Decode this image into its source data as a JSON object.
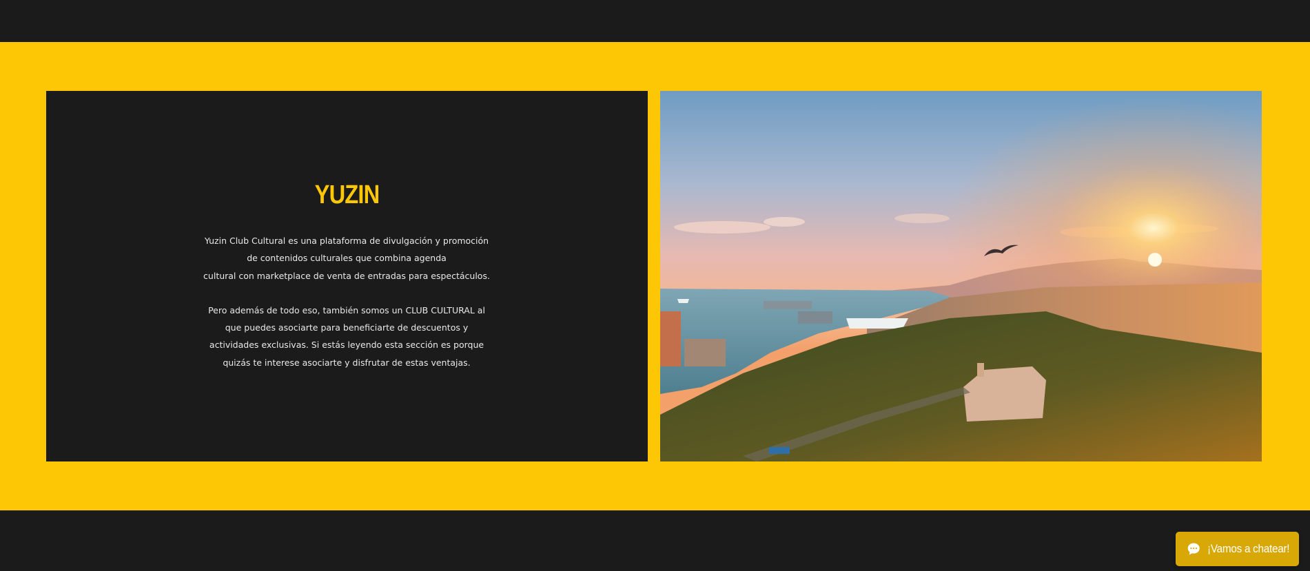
{
  "section": {
    "title": "YUZIN",
    "paragraph_1": [
      "Yuzin Club Cultural es una plataforma de divulgación y promoción",
      "de  contenidos culturales que combina agenda",
      "cultural con marketplace de venta de entradas para espectáculos."
    ],
    "paragraph_2": [
      "Pero además de todo eso, también somos un CLUB CULTURAL al",
      "que puedes asociarte para beneficiarte de descuentos y",
      "actividades exclusivas. Si estás leyendo esta sección es porque",
      "quizás te interese asociarte y disfrutar de estas ventajas."
    ]
  },
  "chat": {
    "label": "¡Vamos a chatear!",
    "icon": "chat-bubble-icon"
  },
  "colors": {
    "accent": "#fdc705",
    "dark": "#1b1b1b",
    "chat_button": "#d8a806"
  }
}
